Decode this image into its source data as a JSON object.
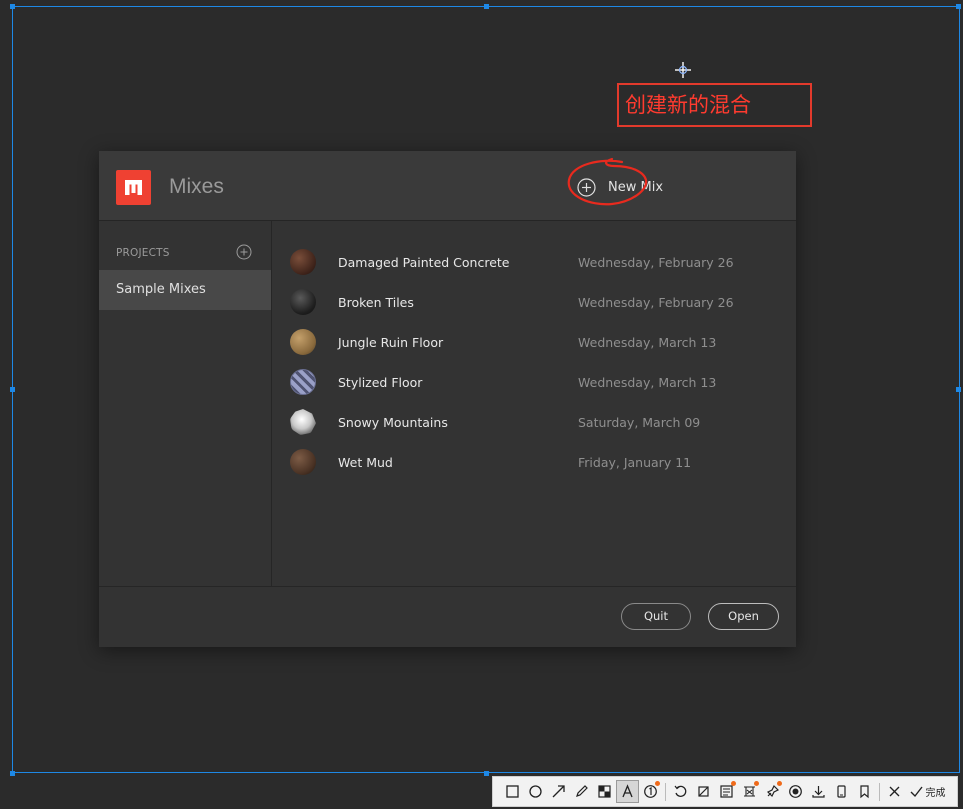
{
  "annotation": {
    "text": "创建新的混合"
  },
  "dialog": {
    "title": "Mixes",
    "new_mix_label": "New Mix",
    "sidebar": {
      "section_label": "PROJECTS",
      "items": [
        {
          "label": "Sample Mixes",
          "selected": true
        }
      ]
    },
    "mixes": [
      {
        "name": "Damaged Painted Concrete",
        "date": "Wednesday, February 26",
        "thumb": "thumb-concrete"
      },
      {
        "name": "Broken Tiles",
        "date": "Wednesday, February 26",
        "thumb": "thumb-tiles"
      },
      {
        "name": "Jungle Ruin Floor",
        "date": "Wednesday, March 13",
        "thumb": "thumb-jungle"
      },
      {
        "name": "Stylized Floor",
        "date": "Wednesday, March 13",
        "thumb": "thumb-stylized"
      },
      {
        "name": "Snowy Mountains",
        "date": "Saturday, March 09",
        "thumb": "thumb-snowy"
      },
      {
        "name": "Wet Mud",
        "date": "Friday, January 11",
        "thumb": "thumb-mud"
      }
    ],
    "footer": {
      "quit_label": "Quit",
      "open_label": "Open"
    }
  },
  "toolbar": {
    "done_label": "完成"
  },
  "colors": {
    "accent": "#ef4132",
    "annotation_red": "#e33a2c",
    "selection_blue": "#1e88e5"
  }
}
